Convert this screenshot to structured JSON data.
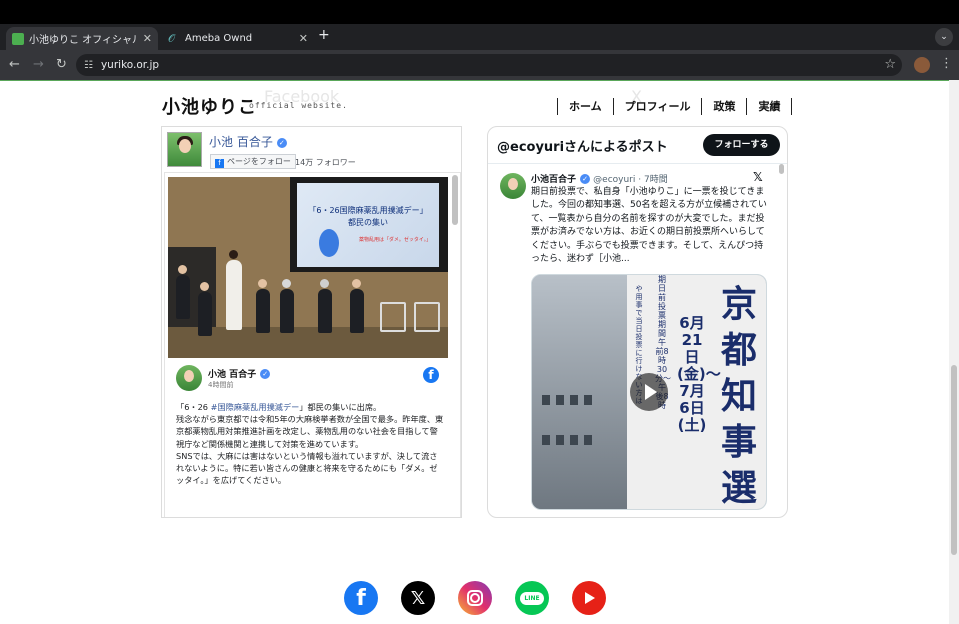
{
  "browser": {
    "tabs": [
      {
        "title": "小池ゆりこ オフィシャルサイト | ",
        "close": "✕"
      },
      {
        "title": "Ameba Ownd",
        "close": "✕"
      }
    ],
    "new_tab": "+",
    "url": "yuriko.or.jp"
  },
  "site": {
    "logo": "小池ゆりこ",
    "logo_sub": "official website.",
    "ghost_facebook": "Facebook",
    "ghost_x": "X",
    "nav": [
      "ホーム",
      "プロフィール",
      "政策",
      "実績"
    ]
  },
  "facebook": {
    "page_name": "小池 百合子",
    "follow_label": "ページをフォロー",
    "followers": "14万 フォロワー",
    "photo": {
      "screen_line1": "「6・26国際麻薬乱用撲滅デー」",
      "screen_line2": "都民の集い",
      "screen_line3": "薬物乱用は「ダメ。ゼッタイ。」"
    },
    "post": {
      "author": "小池 百合子",
      "time": "4時間前",
      "text_prefix": "「6・26 ",
      "hashtag": "#国際麻薬乱用撲滅デー",
      "text_suffix": "」都民の集いに出席。",
      "body": "残念ながら東京都では令和5年の大麻検挙者数が全国で最多。昨年度、東京都薬物乱用対策推進計画を改定し、薬物乱用のない社会を目指して警視庁など関係機関と連携して対策を進めています。",
      "body2": "SNSでは、大麻には害はないという情報も溢れていますが、決して流されないように。特に若い皆さんの健康と将来を守るためにも「ダメ。ゼッタイ。」を広げてください。"
    }
  },
  "x_embed": {
    "title": "@ecoyuriさんによるポスト",
    "follow_label": "フォローする",
    "tweet": {
      "name": "小池百合子",
      "handle": "@ecoyuri · 7時間",
      "text": "期日前投票で、私自身「小池ゆりこ」に一票を投じてきました。今回の都知事選、50名を超える方が立候補されていて、一覧表から自分の名前を探すのが大変でした。まだ投票がお済みでない方は、お近くの期日前投票所へいらしてください。手ぶらでも投票できます。そして、えんぴつ持ったら、迷わず［小池..."
    },
    "media": {
      "big_text": "京都知事選挙",
      "date_text": "6月21日(金)〜7月6日(土)",
      "small_text": "期日前投票期間 午前8時30分〜午後8時",
      "small_text2": "や用事で当日投票に行けない方は"
    }
  },
  "social_links": [
    {
      "name": "facebook"
    },
    {
      "name": "x"
    },
    {
      "name": "instagram"
    },
    {
      "name": "line",
      "label": "LINE"
    },
    {
      "name": "youtube"
    }
  ]
}
